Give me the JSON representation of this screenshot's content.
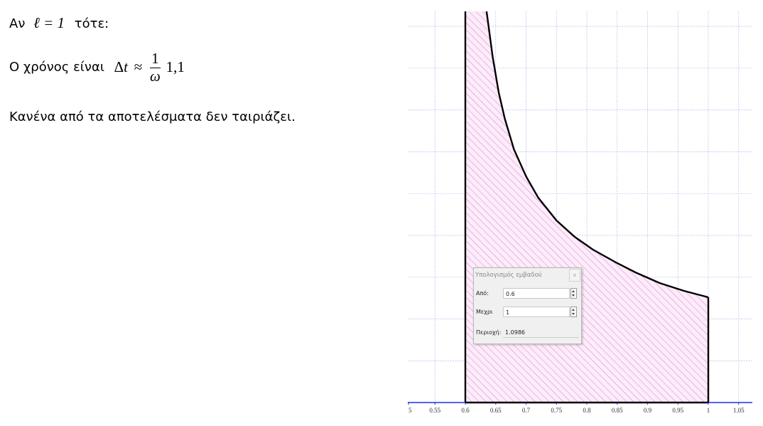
{
  "doc": {
    "line1": {
      "prefix": "Αν",
      "math": "ℓ = 1",
      "suffix": "τότε:"
    },
    "line2": {
      "prefix": "Ο χρόνος είναι",
      "delta": "Δ",
      "t": "t",
      "approx": "≈",
      "numerator": "1",
      "denominator": "ω",
      "value": "1,1"
    },
    "line3": "Κανένα από τα αποτελέσματα δεν ταιριάζει."
  },
  "graph": {
    "x_ticks": [
      "5",
      "0.55",
      "0.6",
      "0.65",
      "0.7",
      "0.75",
      "0.8",
      "0.85",
      "0.9",
      "0.95",
      "1",
      "1.05"
    ],
    "colors": {
      "grid": "#b8b8f0",
      "axis": "#1e2fe0",
      "curve": "#000000",
      "hatch": "#d060c8",
      "fill": "#fbeaf8"
    }
  },
  "chart_data": {
    "type": "area",
    "x_tick_labels": [
      "5",
      "0.55",
      "0.6",
      "0.65",
      "0.7",
      "0.75",
      "0.8",
      "0.85",
      "0.9",
      "0.95",
      "1",
      "1.05"
    ],
    "xlim": [
      0.5,
      1.07
    ],
    "shaded_interval": [
      0.6,
      1
    ],
    "area": "1.0986"
  },
  "dialog": {
    "title": "Υπολογισμός εμβαδού",
    "close_label": "x",
    "from_label": "Από:",
    "from_value": "0.6",
    "to_label": "Μεχρι",
    "to_value": "1",
    "area_label": "Περιοχή:",
    "area_value": "1.0986"
  }
}
